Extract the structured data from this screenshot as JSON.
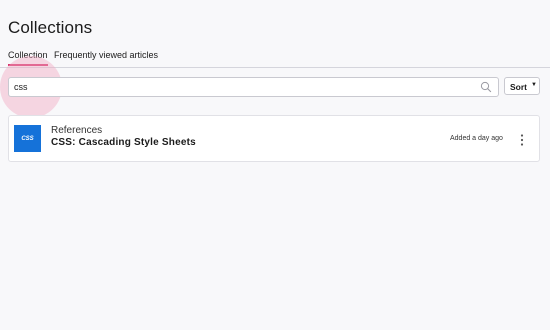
{
  "header": {
    "title": "Collections"
  },
  "tabs": [
    {
      "label": "Collection",
      "active": true
    },
    {
      "label": "Frequently viewed articles",
      "active": false
    }
  ],
  "search": {
    "value": "css",
    "placeholder": "",
    "icon": "search-icon"
  },
  "sort": {
    "label": "Sort",
    "caret": "▼"
  },
  "colors": {
    "accent": "#d6336c",
    "css_logo_bg": "#1572d9"
  },
  "items": [
    {
      "logo_text": "CSS",
      "category": "References",
      "title": "CSS: Cascading Style Sheets",
      "added": "Added a day ago",
      "menu_icon": "more-vertical-icon"
    }
  ]
}
